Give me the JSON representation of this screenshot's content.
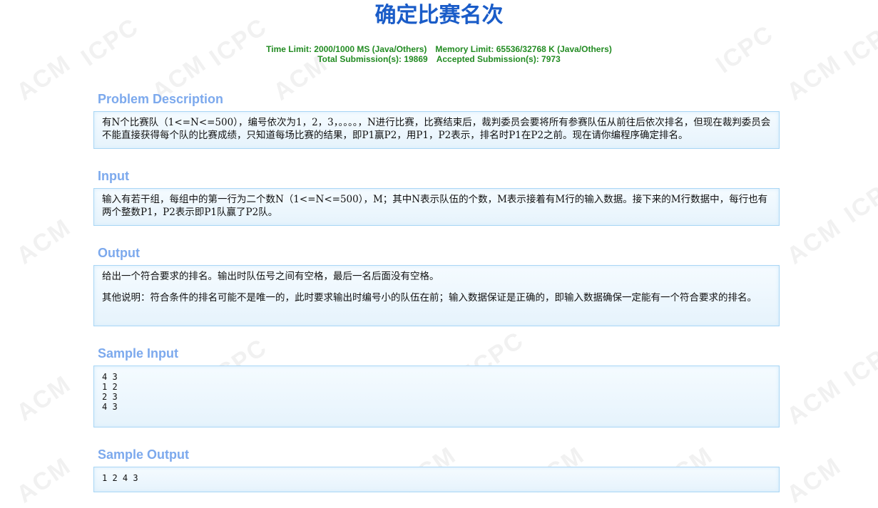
{
  "problem": {
    "title": "确定比赛名次",
    "limits": {
      "time_limit": "Time Limit: 2000/1000 MS (Java/Others)",
      "memory_limit": "Memory Limit: 65536/32768 K (Java/Others)",
      "total_submissions": "Total Submission(s): 19869",
      "accepted_submissions": "Accepted Submission(s): 7973"
    }
  },
  "sections": {
    "description": {
      "title": "Problem Description",
      "text": "有N个比赛队（1<=N<=500），编号依次为1，2，3，。。。。，N进行比赛，比赛结束后，裁判委员会要将所有参赛队伍从前往后依次排名，但现在裁判委员会不能直接获得每个队的比赛成绩，只知道每场比赛的结果，即P1赢P2，用P1，P2表示，排名时P1在P2之前。现在请你编程序确定排名。"
    },
    "input": {
      "title": "Input",
      "text": "输入有若干组，每组中的第一行为二个数N（1<=N<=500），M；其中N表示队伍的个数，M表示接着有M行的输入数据。接下来的M行数据中，每行也有两个整数P1，P2表示即P1队赢了P2队。"
    },
    "output": {
      "title": "Output",
      "text1": "给出一个符合要求的排名。输出时队伍号之间有空格，最后一名后面没有空格。",
      "text2": "其他说明：符合条件的排名可能不是唯一的，此时要求输出时编号小的队伍在前；输入数据保证是正确的，即输入数据确保一定能有一个符合要求的排名。"
    },
    "sample_input": {
      "title": "Sample Input",
      "text": "4 3\n1 2\n2 3\n4 3"
    },
    "sample_output": {
      "title": "Sample Output",
      "text": "1 2 4 3"
    }
  },
  "watermark": {
    "texts": [
      "ACM",
      "ICPC"
    ]
  }
}
